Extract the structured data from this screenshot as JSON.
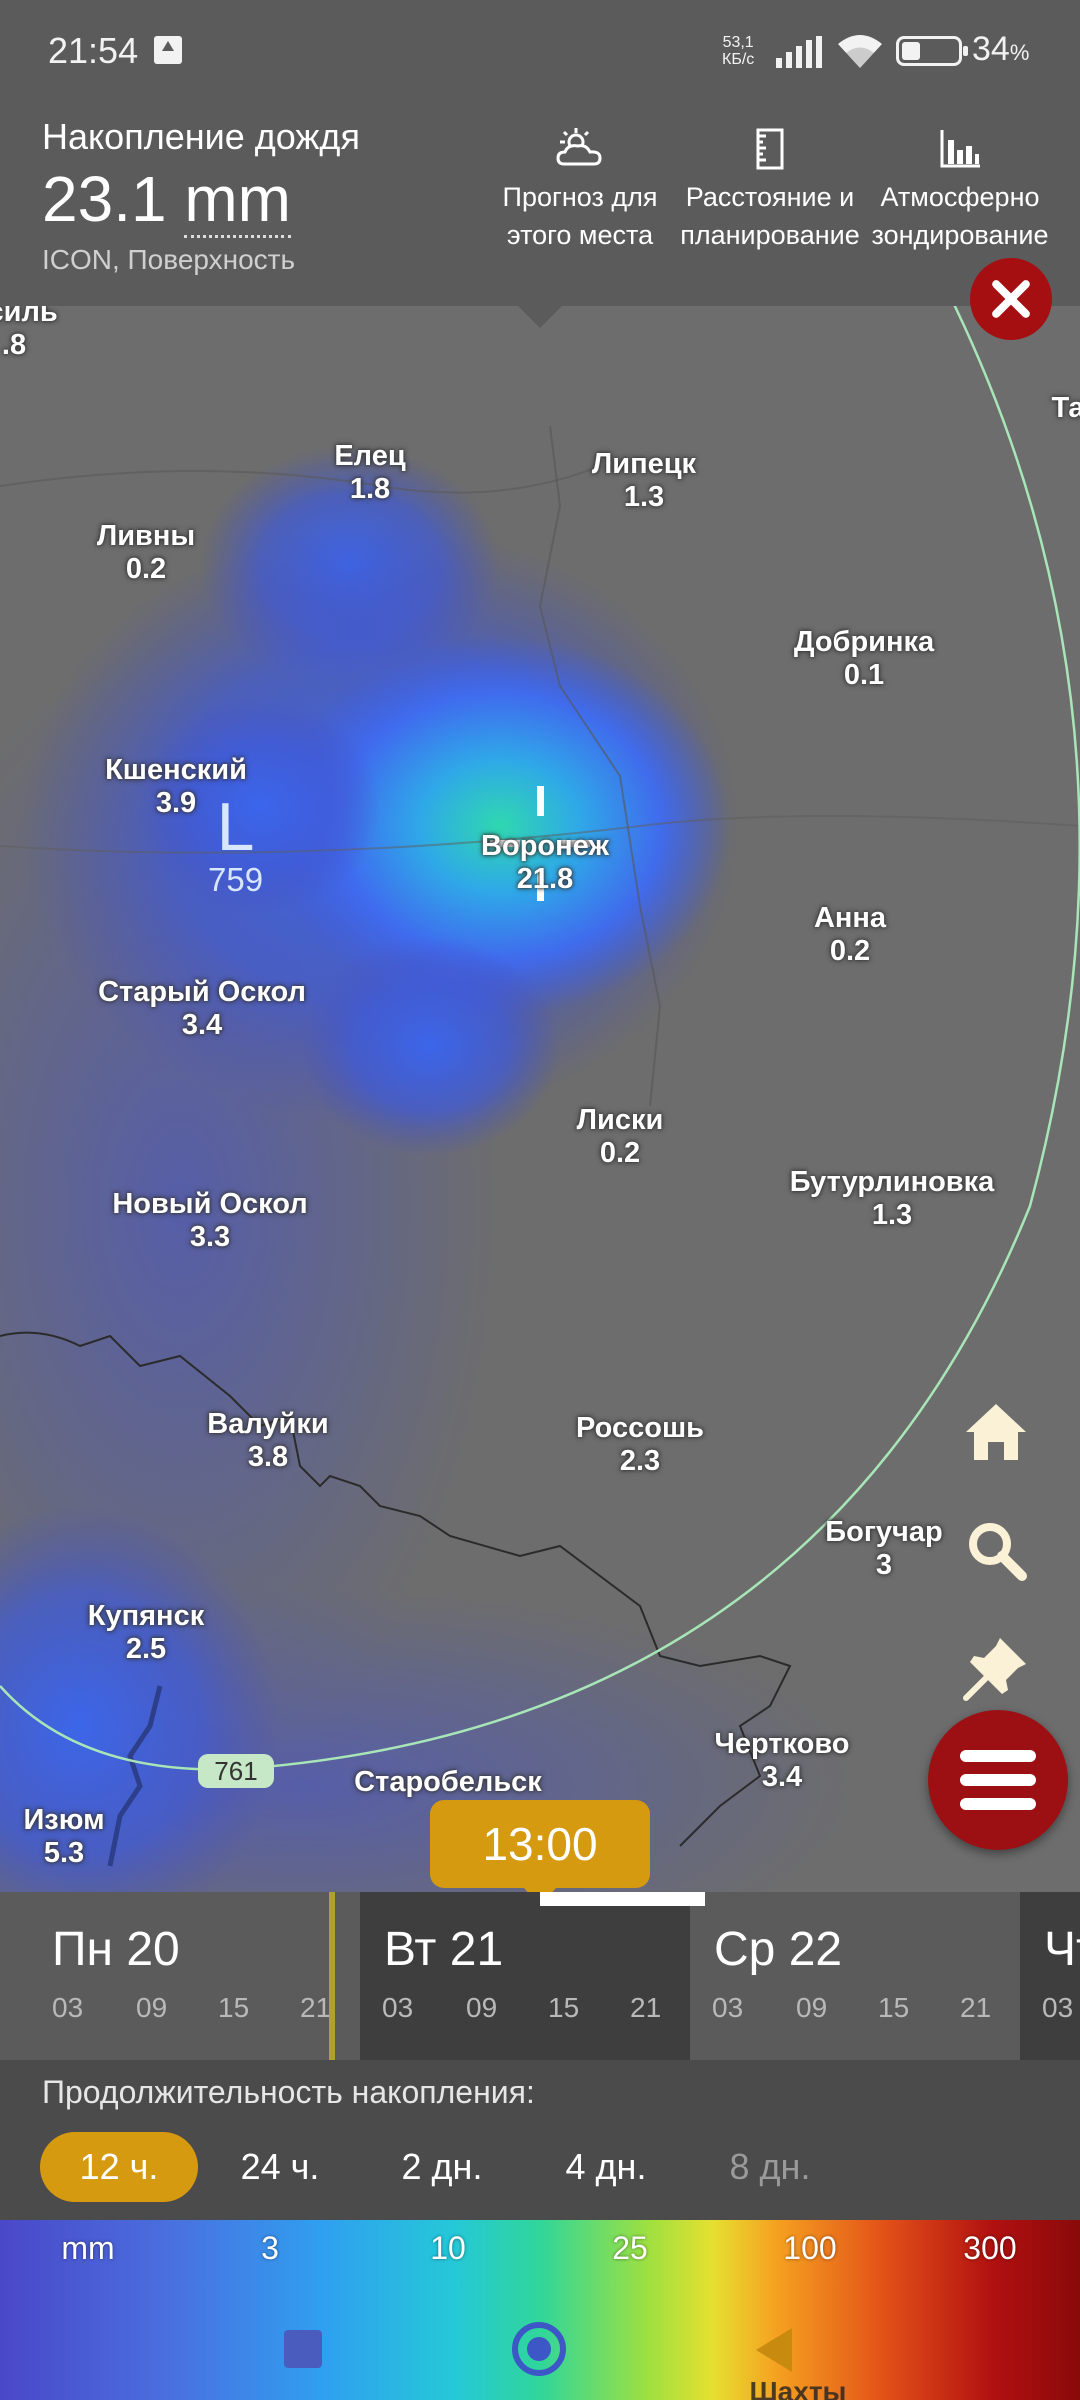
{
  "status_bar": {
    "time": "21:54",
    "speed_value": "53,1",
    "speed_unit": "КБ/с",
    "battery": "34",
    "battery_suffix": "%"
  },
  "header": {
    "title": "Накопление дождя",
    "value": "23.1",
    "unit": "mm",
    "model": "ICON, Поверхность",
    "actions": [
      {
        "label": "Прогноз для\nэтого места",
        "icon": "weather-cloud-sun-icon"
      },
      {
        "label": "Расстояние и\nпланирование",
        "icon": "ruler-icon"
      },
      {
        "label": "Атмосферно\nзондирование",
        "icon": "bar-chart-icon"
      }
    ]
  },
  "map": {
    "cities": [
      {
        "name": "осиль",
        "value": ".8"
      },
      {
        "name": "Елец",
        "value": "1.8"
      },
      {
        "name": "Липецк",
        "value": "1.3"
      },
      {
        "name": "Ливны",
        "value": "0.2"
      },
      {
        "name": "Добринка",
        "value": "0.1"
      },
      {
        "name": "Кшенский",
        "value": "3.9"
      },
      {
        "name": "Воронеж",
        "value": "21.8"
      },
      {
        "name": "Анна",
        "value": "0.2"
      },
      {
        "name": "Старый Оскол",
        "value": "3.4"
      },
      {
        "name": "Лиски",
        "value": "0.2"
      },
      {
        "name": "Бутурлиновка",
        "value": "1.3"
      },
      {
        "name": "Новый Оскол",
        "value": "3.3"
      },
      {
        "name": "Валуйки",
        "value": "3.8"
      },
      {
        "name": "Россошь",
        "value": "2.3"
      },
      {
        "name": "Богучар",
        "value": "3"
      },
      {
        "name": "Купянск",
        "value": "2.5"
      },
      {
        "name": "Чертково",
        "value": "3.4"
      },
      {
        "name": "Изюм",
        "value": "5.3"
      },
      {
        "name": "Старобельск",
        "value": ""
      },
      {
        "name": "Та",
        "value": ""
      }
    ],
    "pressure_low": {
      "letter": "L",
      "value": "759"
    },
    "road_badge": "761",
    "bottom_city": "Шахты"
  },
  "tools": [
    "home-icon",
    "search-icon",
    "pin-icon",
    "heart-icon",
    "menu-icon"
  ],
  "time_bubble": "13:00",
  "timeline": {
    "days": [
      {
        "label": "Пн 20",
        "hours": [
          "03",
          "09",
          "15",
          "21"
        ]
      },
      {
        "label": "Вт 21",
        "hours": [
          "03",
          "09",
          "15",
          "21"
        ]
      },
      {
        "label": "Ср 22",
        "hours": [
          "03",
          "09",
          "15",
          "21"
        ]
      },
      {
        "label": "Чт",
        "hours": [
          "03"
        ]
      }
    ],
    "selected_index": 1
  },
  "accumulation": {
    "title": "Продолжительность накопления:",
    "options": [
      "12 ч.",
      "24 ч.",
      "2 дн.",
      "4 дн.",
      "8 дн."
    ],
    "active_index": 0,
    "disabled_index": 4
  },
  "legend": {
    "unit": "mm",
    "labels": [
      "3",
      "10",
      "25",
      "100",
      "300"
    ]
  },
  "colors": {
    "accent": "#d69a10",
    "close_red": "#a50f12",
    "menu_red": "#9c1014",
    "header_bg": "#5b5b5b"
  }
}
